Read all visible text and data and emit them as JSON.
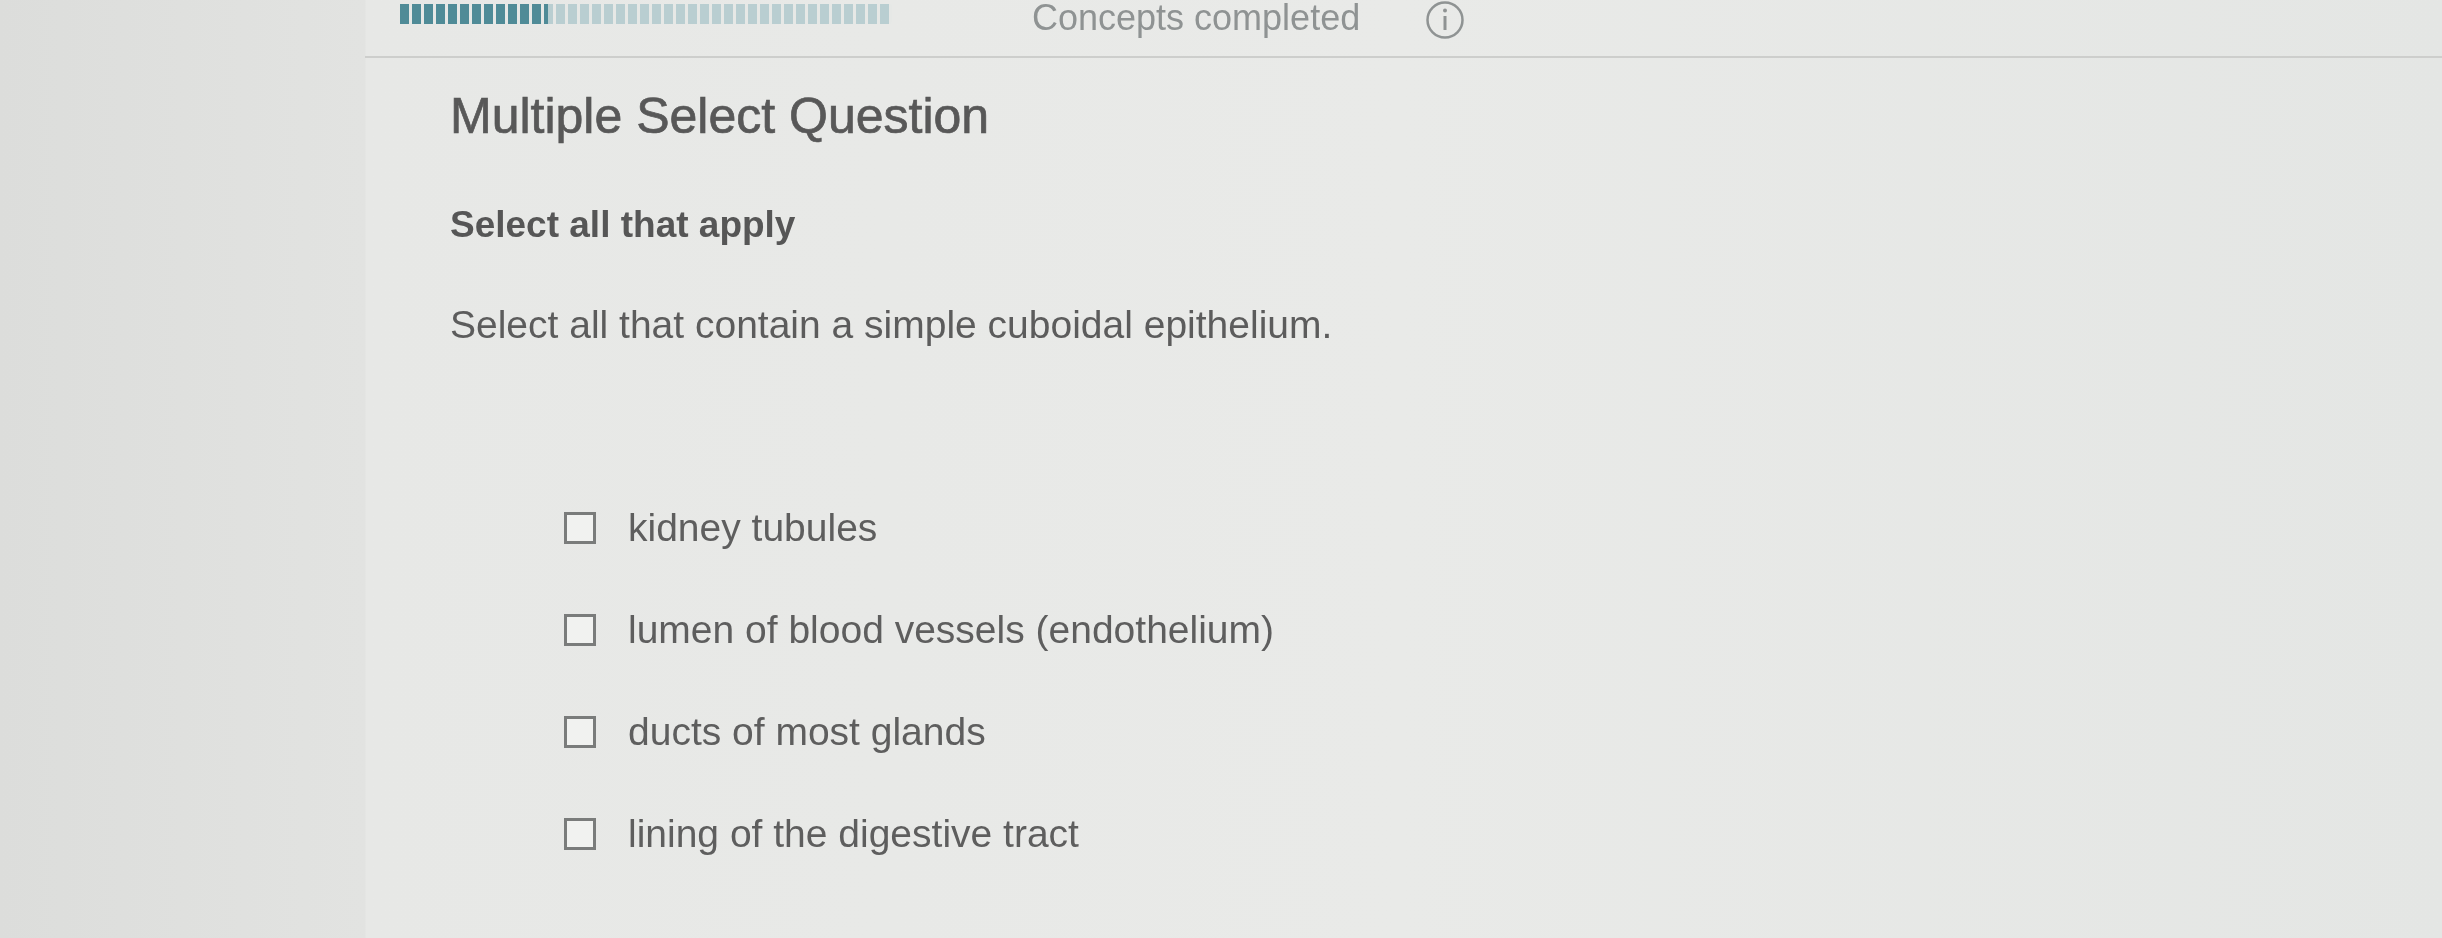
{
  "progress": {
    "level": 0.3,
    "label": "Concepts completed"
  },
  "question": {
    "type": "Multiple Select Question",
    "instruction": "Select all that apply",
    "prompt": "Select all that contain a simple cuboidal epithelium."
  },
  "options": [
    {
      "label": "kidney tubules",
      "checked": false
    },
    {
      "label": "lumen of blood vessels (endothelium)",
      "checked": false
    },
    {
      "label": "ducts of most glands",
      "checked": false
    },
    {
      "label": "lining of the digestive tract",
      "checked": false
    }
  ]
}
